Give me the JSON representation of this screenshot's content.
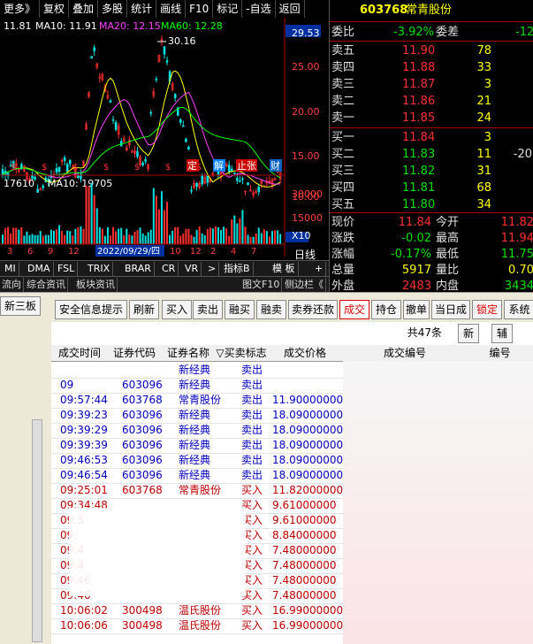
{
  "menu": [
    "更多》",
    "复权",
    "叠加",
    "多股",
    "统计",
    "画线",
    "F10",
    "标记",
    "-自选",
    "返回"
  ],
  "chart": {
    "ma_line": {
      "ma_close": "11.81",
      "ma10": "MA10: 11.91",
      "ma20": "MA20: 12.15",
      "ma60": "MA60: 12.28"
    },
    "y_ticks": [
      "29.53",
      "25.00",
      "20.00",
      "15.00",
      "10.00"
    ],
    "peak_label": "30.16",
    "vol_line": {
      "vol": "17610",
      "ma10": "MA10: 19705"
    },
    "vol_ticks": [
      "30000",
      "15000",
      "X10"
    ],
    "date_label": "2022/09/29/四",
    "x_ticks": [
      "3",
      "6",
      "9",
      "12",
      "2",
      "4",
      "6",
      "8",
      "10",
      "12",
      "2",
      "4",
      "7"
    ],
    "period": "日线",
    "markers": [
      "定",
      "解",
      "止张",
      "财"
    ],
    "indicator_tabs": [
      "MI",
      "DMA",
      "FSL",
      "TRIX",
      "BRAR",
      "CR",
      "VR",
      ">",
      "指标B",
      "模 板",
      "+",
      "-"
    ],
    "info_tabs": [
      "流向",
      "综合资讯",
      "板块资讯",
      "图文F10",
      "侧边栏《"
    ],
    "colors": {
      "up": "#ff3030",
      "down": "#00e0e0",
      "ma20": "#ff40ff",
      "ma60": "#00ff00",
      "ma10": "#ffff00"
    }
  },
  "quote": {
    "code": "603768",
    "name": "常青股份",
    "weibi_label": "委比",
    "weibi": "-3.92%",
    "weicha_label": "委差",
    "weicha": "-12",
    "asks": [
      {
        "label": "卖五",
        "price": "11.90",
        "vol": "78"
      },
      {
        "label": "卖四",
        "price": "11.88",
        "vol": "33"
      },
      {
        "label": "卖三",
        "price": "11.87",
        "vol": "3"
      },
      {
        "label": "卖二",
        "price": "11.86",
        "vol": "21"
      },
      {
        "label": "卖一",
        "price": "11.85",
        "vol": "24"
      }
    ],
    "bids": [
      {
        "label": "买一",
        "price": "11.84",
        "vol": "3",
        "extra": ""
      },
      {
        "label": "买二",
        "price": "11.83",
        "vol": "11",
        "extra": "-20"
      },
      {
        "label": "买三",
        "price": "11.82",
        "vol": "31",
        "extra": ""
      },
      {
        "label": "买四",
        "price": "11.81",
        "vol": "68",
        "extra": ""
      },
      {
        "label": "买五",
        "price": "11.80",
        "vol": "34",
        "extra": ""
      }
    ],
    "stats": [
      {
        "l1": "现价",
        "v1": "11.84",
        "l2": "今开",
        "v2": "11.82"
      },
      {
        "l1": "涨跌",
        "v1": "-0.02",
        "l2": "最高",
        "v2": "11.94"
      },
      {
        "l1": "涨幅",
        "v1": "-0.17%",
        "l2": "最低",
        "v2": "11.75"
      },
      {
        "l1": "总量",
        "v1": "5917",
        "l2": "量比",
        "v2": "0.70"
      },
      {
        "l1": "外盘",
        "v1": "2483",
        "l2": "内盘",
        "v2": "3434"
      }
    ]
  },
  "toolbar": {
    "left_tab": "新三板",
    "buttons": [
      "安全信息提示",
      "刷新",
      "买入",
      "卖出",
      "融买",
      "融卖",
      "卖券还款",
      "成交",
      "持仓",
      "撤单",
      "当日成交",
      "锁定",
      "系统"
    ]
  },
  "grid": {
    "count_label": "共47条",
    "mini_buttons": [
      "新",
      "辅"
    ],
    "headers": [
      "成交时间",
      "证券代码",
      "证券名称",
      "▽买卖标志",
      "成交价格",
      "成交编号",
      "编号"
    ],
    "rows": [
      {
        "time": "",
        "code": "",
        "name": "新经典",
        "side": "卖出",
        "price": "",
        "color": "blue"
      },
      {
        "time": "09",
        "code": "603096",
        "name": "新经典",
        "side": "卖出",
        "price": "",
        "color": "blue"
      },
      {
        "time": "09:57:44",
        "code": "603768",
        "name": "常青股份",
        "side": "卖出",
        "price": "11.90000000",
        "color": "blue"
      },
      {
        "time": "09:39:23",
        "code": "603096",
        "name": "新经典",
        "side": "卖出",
        "price": "18.09000000",
        "color": "blue"
      },
      {
        "time": "09:39:29",
        "code": "603096",
        "name": "新经典",
        "side": "卖出",
        "price": "18.09000000",
        "color": "blue"
      },
      {
        "time": "09:39:39",
        "code": "603096",
        "name": "新经典",
        "side": "卖出",
        "price": "18.09000000",
        "color": "blue"
      },
      {
        "time": "09:46:53",
        "code": "603096",
        "name": "新经典",
        "side": "卖出",
        "price": "18.09000000",
        "color": "blue"
      },
      {
        "time": "09:46:54",
        "code": "603096",
        "name": "新经典",
        "side": "卖出",
        "price": "18.09000000",
        "color": "blue"
      },
      {
        "time": "09:25:01",
        "code": "603768",
        "name": "常青股份",
        "side": "买入",
        "price": "11.82000000",
        "color": "red"
      },
      {
        "time": "09:34:48",
        "code": "",
        "name": "",
        "side": "买入",
        "price": "9.61000000",
        "color": "red"
      },
      {
        "time": "09:3",
        "code": "",
        "name": "",
        "side": "买入",
        "price": "9.61000000",
        "color": "red"
      },
      {
        "time": "09:",
        "code": "",
        "name": "",
        "side": "买入",
        "price": "8.84000000",
        "color": "red"
      },
      {
        "time": "09:4",
        "code": "",
        "name": "",
        "side": "买入",
        "price": "7.48000000",
        "color": "red"
      },
      {
        "time": "09:4",
        "code": "",
        "name": "",
        "side": "买入",
        "price": "7.48000000",
        "color": "red"
      },
      {
        "time": "09:46",
        "code": "",
        "name": "",
        "side": "买入",
        "price": "7.48000000",
        "color": "red"
      },
      {
        "time": "09:46",
        "code": "",
        "name": "",
        "side": "买入",
        "price": "7.48000000",
        "color": "red"
      },
      {
        "time": "10:06:02",
        "code": "300498",
        "name": "温氏股份",
        "side": "买入",
        "price": "16.99000000",
        "color": "red"
      },
      {
        "time": "10:06:06",
        "code": "300498",
        "name": "温氏股份",
        "side": "买入",
        "price": "16.99000000",
        "color": "red"
      }
    ]
  }
}
